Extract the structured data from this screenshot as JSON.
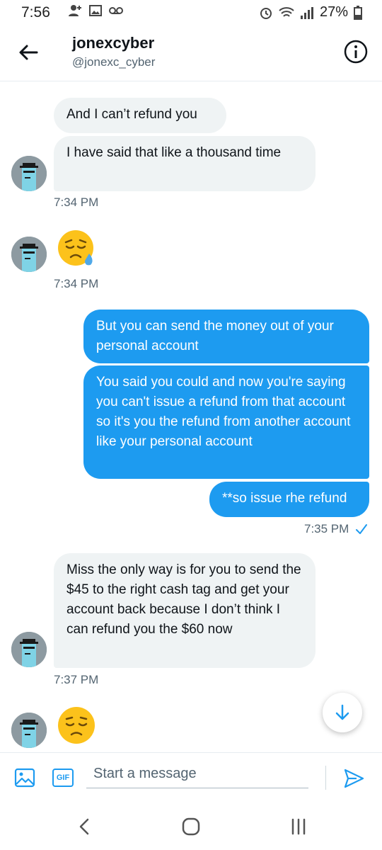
{
  "status_bar": {
    "time": "7:56",
    "battery": "27%"
  },
  "header": {
    "title": "jonexcyber",
    "handle": "@jonexc_cyber"
  },
  "messages": {
    "m1": "And I can’t refund you",
    "m2": "I have said that like a thousand time",
    "ts1": "7:34 PM",
    "ts2": "7:34 PM",
    "m3": "But you can send the money out of your personal account",
    "m4": "You said you could and now you're saying you can't issue a refund from that account so it's you the refund from another account like your personal account",
    "m5": "**so issue rhe refund",
    "ts3": "7:35 PM",
    "m6": "Miss the only way is for you to send the $45 to the right cash tag and get your account back because I don’t think I can refund you the $60 now",
    "ts4": "7:37 PM"
  },
  "composer": {
    "placeholder": "Start a message",
    "gif_label": "GIF"
  },
  "icons": {
    "back": "arrow-left-icon",
    "info": "info-icon",
    "image": "image-icon",
    "gif": "gif-icon",
    "send": "send-icon",
    "scroll": "arrow-down-icon",
    "emoji1": "sad-relieved-face-emoji",
    "emoji2": "pensive-face-emoji"
  },
  "colors": {
    "accent": "#1d9bf0",
    "incoming_bubble": "#eff3f4",
    "secondary_text": "#536471"
  }
}
